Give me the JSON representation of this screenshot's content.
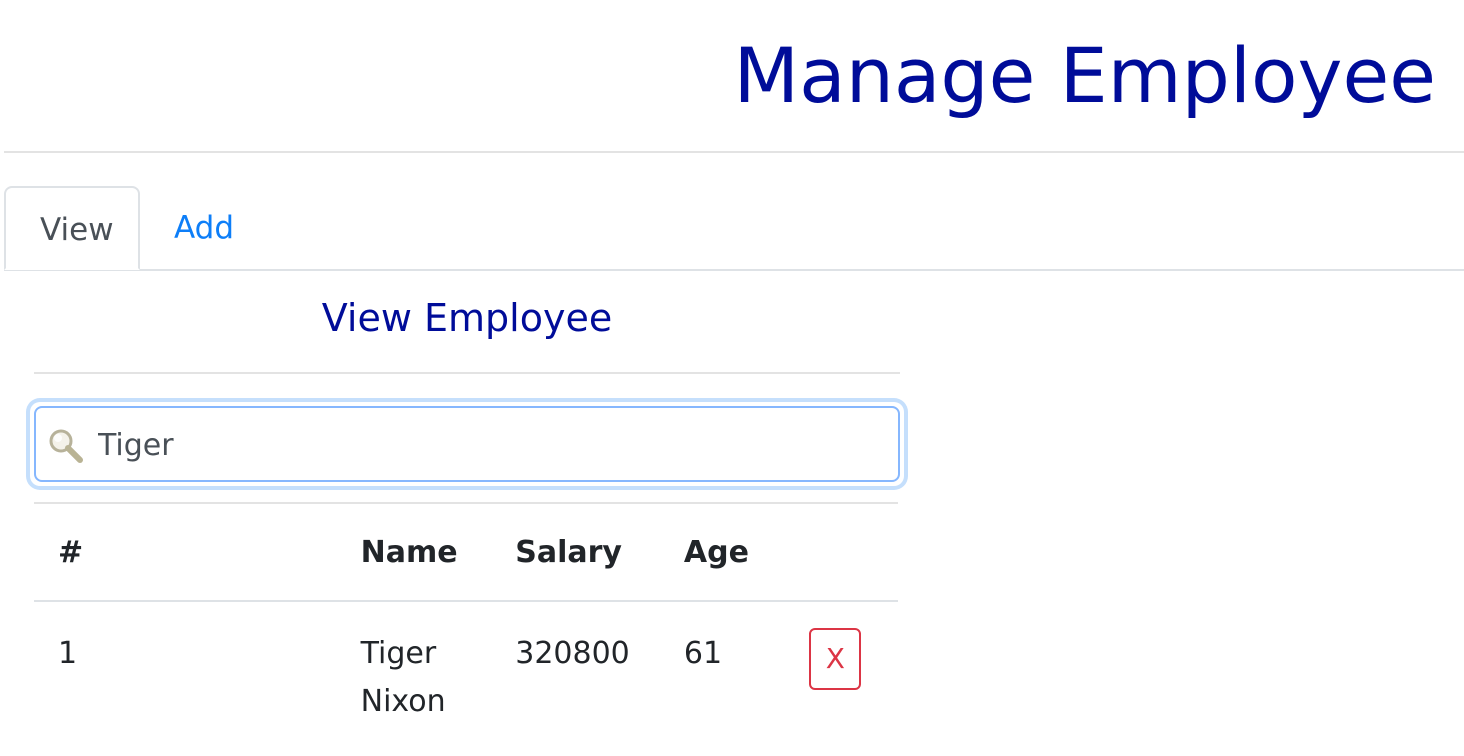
{
  "header": {
    "title": "Manage Employee"
  },
  "tabs": [
    {
      "label": "View",
      "active": true
    },
    {
      "label": "Add",
      "active": false
    }
  ],
  "view": {
    "title": "View Employee",
    "search": {
      "value": "Tiger",
      "placeholder": ""
    },
    "table": {
      "columns": [
        "#",
        "Name",
        "Salary",
        "Age",
        ""
      ],
      "rows": [
        {
          "index": "1",
          "name": "Tiger Nixon",
          "salary": "320800",
          "age": "61",
          "delete_label": "X"
        }
      ]
    }
  },
  "icons": {
    "search": "search-icon"
  },
  "colors": {
    "title": "#000c99",
    "link": "#0d7ef8",
    "danger": "#dc3545",
    "focus_border": "#86b7fe"
  }
}
